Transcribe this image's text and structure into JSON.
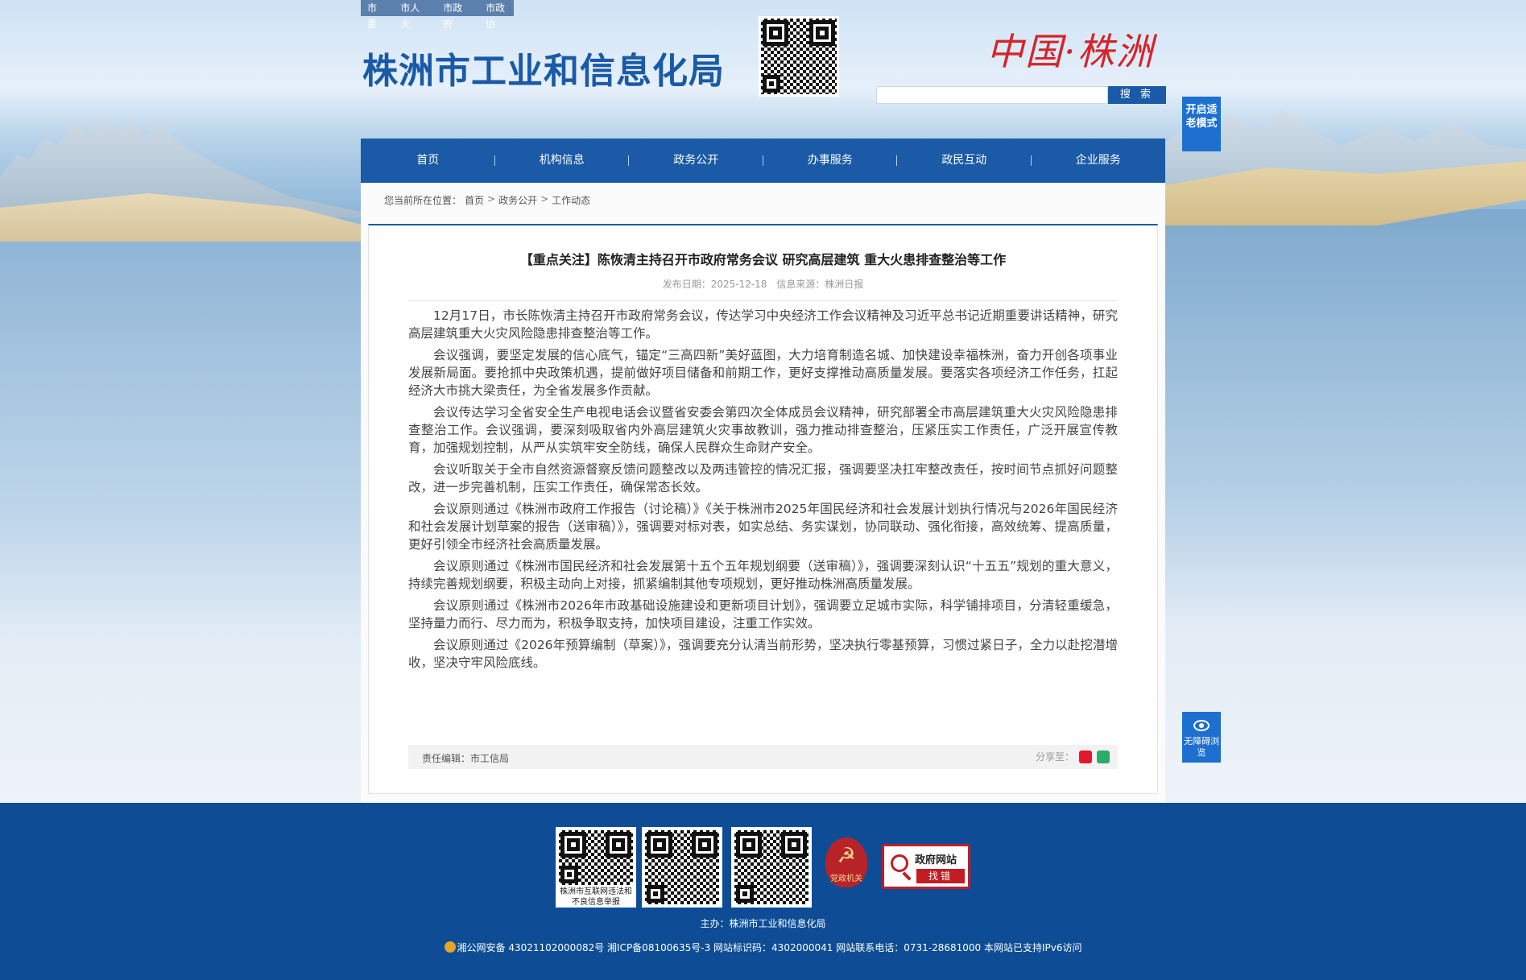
{
  "topbar": {
    "links": [
      "市委",
      "市人大",
      "市政府",
      "市政协"
    ]
  },
  "header": {
    "site_title": "株洲市工业和信息化局",
    "logo_text": "中国·株洲",
    "search_placeholder": "",
    "search_button": "搜 索",
    "elder_mode": "开启适老模式"
  },
  "nav": {
    "items": [
      "首页",
      "机构信息",
      "政务公开",
      "办事服务",
      "政民互动",
      "企业服务"
    ]
  },
  "breadcrumb": {
    "prefix": "您当前所在位置：",
    "items": [
      "首页",
      "政务公开",
      "工作动态"
    ],
    "sep": ">"
  },
  "article": {
    "title": "【重点关注】陈恢清主持召开市政府常务会议 研究高层建筑 重大火患排查整治等工作",
    "date_label": "发布日期：2025-12-18",
    "source_label": "信息来源：株洲日报",
    "paragraphs": [
      "12月17日，市长陈恢清主持召开市政府常务会议，传达学习中央经济工作会议精神及习近平总书记近期重要讲话精神，研究高层建筑重大火灾风险隐患排查整治等工作。",
      "会议强调，要坚定发展的信心底气，锚定“三高四新”美好蓝图，大力培育制造名城、加快建设幸福株洲，奋力开创各项事业发展新局面。要抢抓中央政策机遇，提前做好项目储备和前期工作，更好支撑推动高质量发展。要落实各项经济工作任务，扛起经济大市挑大梁责任，为全省发展多作贡献。",
      "会议传达学习全省安全生产电视电话会议暨省安委会第四次全体成员会议精神，研究部署全市高层建筑重大火灾风险隐患排查整治工作。会议强调，要深刻吸取省内外高层建筑火灾事故教训，强力推动排查整治，压紧压实工作责任，广泛开展宣传教育，加强规划控制，从严从实筑牢安全防线，确保人民群众生命财产安全。",
      "会议听取关于全市自然资源督察反馈问题整改以及两违管控的情况汇报，强调要坚决扛牢整改责任，按时间节点抓好问题整改，进一步完善机制，压实工作责任，确保常态长效。",
      "会议原则通过《株洲市政府工作报告（讨论稿）》《关于株洲市2025年国民经济和社会发展计划执行情况与2026年国民经济和社会发展计划草案的报告（送审稿）》，强调要对标对表，如实总结、务实谋划，协同联动、强化衔接，高效统筹、提高质量，更好引领全市经济社会高质量发展。",
      "会议原则通过《株洲市国民经济和社会发展第十五个五年规划纲要（送审稿）》，强调要深刻认识“十五五”规划的重大意义，持续完善规划纲要，积极主动向上对接，抓紧编制其他专项规划，更好推动株洲高质量发展。",
      "会议原则通过《株洲市2026年市政基础设施建设和更新项目计划》，强调要立足城市实际，科学铺排项目，分清轻重缓急，坚持量力而行、尽力而为，积极争取支持，加快项目建设，注重工作实效。",
      "会议原则通过《2026年预算编制（草案）》，强调要充分认清当前形势，坚决执行零基预算，习惯过紧日子，全力以赴挖潜增收，坚决守牢风险底线。"
    ],
    "editor_label": "责任编辑：市工信局",
    "share_label": "分享至："
  },
  "a11y": {
    "label": "无障碍浏览"
  },
  "footer": {
    "qr1_caption": "株洲市互联网违法和不良信息举报",
    "party_badge": "党政机关",
    "gov_err_title": "政府网站",
    "gov_err_action": "找错",
    "host": "主办：株洲市工业和信息化局",
    "record": "湘公网安备 43021102000082号 湘ICP备08100635号-3 网站标识码：4302000041 网站联系电话：0731-28681000 本网站已支持IPv6访问"
  },
  "colors": {
    "brand_blue": "#1a5aa6",
    "accent_blue": "#1d6fd0",
    "footer_blue": "#0e4d96",
    "red": "#c31c24"
  }
}
